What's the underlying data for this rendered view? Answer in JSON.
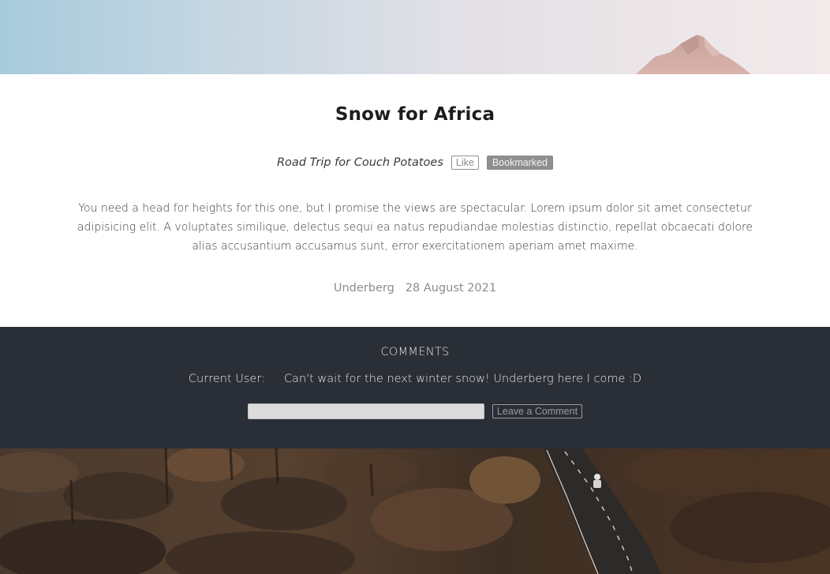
{
  "post": {
    "title": "Snow for Africa",
    "category": "Road Trip for Couch Potatoes",
    "like_label": "Like",
    "bookmark_label": "Bookmarked",
    "body": "You need a head for heights for this one, but I promise the views are spectacular. Lorem ipsum dolor sit amet consectetur adipisicing elit. A voluptates similique, delectus sequi ea natus repudiandae molestias distinctio, repellat obcaecati dolore alias accusantium accusamus sunt, error exercitationem aperiam amet maxime.",
    "location": "Underberg",
    "date": "28 August 2021"
  },
  "comments": {
    "heading": "COMMENTS",
    "items": [
      {
        "author": "Current User:",
        "text": "Can't wait for the next winter snow! Underberg here I come :D"
      }
    ],
    "input_placeholder": "",
    "submit_label": "Leave a Comment"
  },
  "colors": {
    "card_bg": "#ffffff",
    "comments_bg": "#2a2e36",
    "bookmarked_bg": "#8f8f8f"
  }
}
